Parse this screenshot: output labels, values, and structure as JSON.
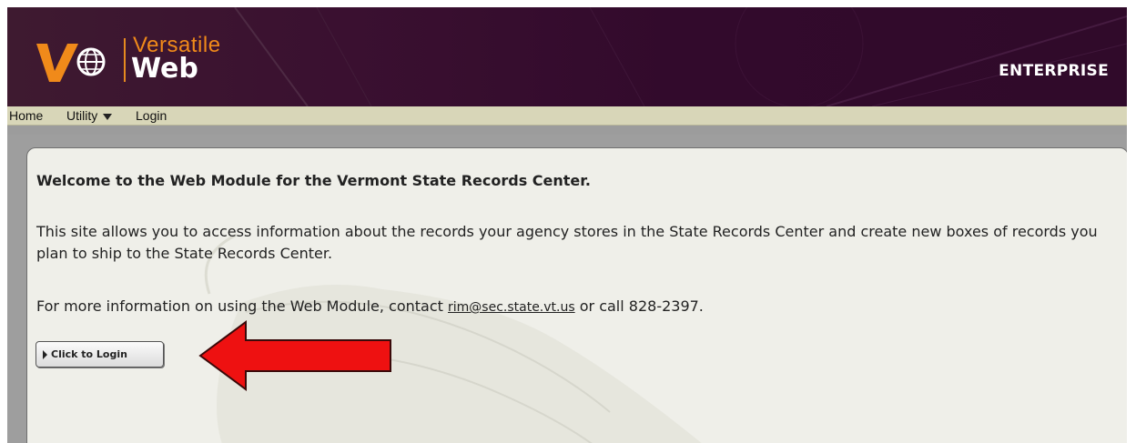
{
  "header": {
    "brand_top": "Versatile",
    "brand_bottom": "Web",
    "edition": "ENTERPRISE",
    "logo_icon": "vw-globe-logo-icon"
  },
  "menu": {
    "items": [
      {
        "label": "Home"
      },
      {
        "label": "Utility",
        "icon": "dropdown-triangle-icon"
      },
      {
        "label": "Login"
      }
    ]
  },
  "content": {
    "welcome": "Welcome to the Web Module for the Vermont State Records Center.",
    "description": "This site allows you to access information about the records your agency stores in the State Records Center and create new boxes of records you plan to ship to the State Records Center.",
    "contact_prefix": "For more information on using the Web Module, contact ",
    "contact_email": "rim@sec.state.vt.us",
    "contact_suffix": " or call 828-2397.",
    "login_button": "Click to Login"
  },
  "annotation": {
    "icon": "red-left-arrow-icon",
    "color": "#ee1111"
  },
  "colors": {
    "header_bg": "#320a2c",
    "brand_orange": "#f08a1a",
    "menubar_bg": "#d8d6b8",
    "panel_bg": "#efefe9"
  }
}
